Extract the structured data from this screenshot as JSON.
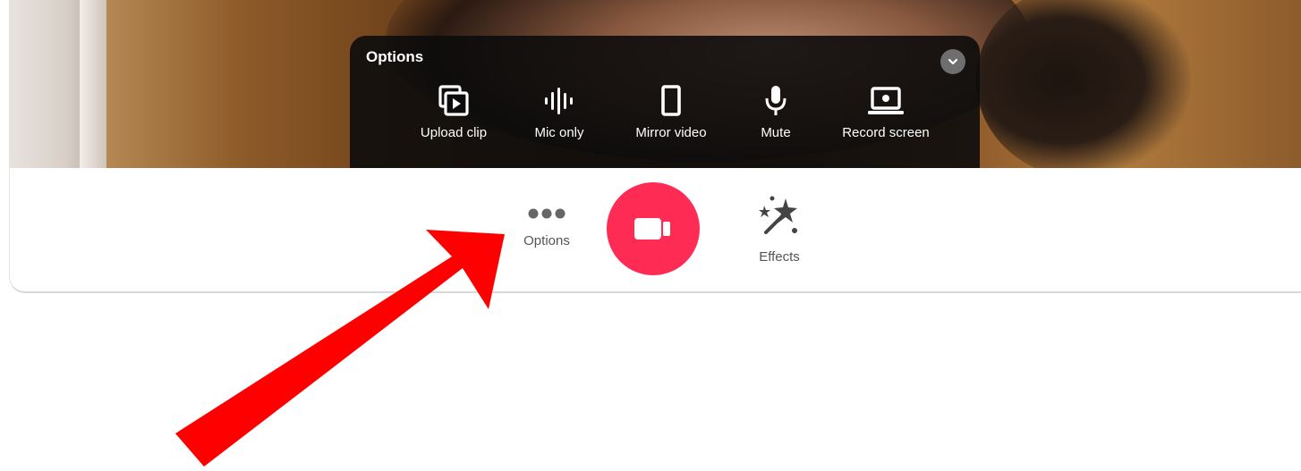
{
  "panel": {
    "title": "Options",
    "tools": [
      {
        "label": "Upload clip",
        "icon": "upload-clip-icon"
      },
      {
        "label": "Mic only",
        "icon": "waveform-icon"
      },
      {
        "label": "Mirror video",
        "icon": "phone-frame-icon"
      },
      {
        "label": "Mute",
        "icon": "microphone-icon"
      },
      {
        "label": "Record screen",
        "icon": "laptop-icon"
      }
    ]
  },
  "bar": {
    "options_label": "Options",
    "effects_label": "Effects"
  },
  "colors": {
    "record": "#fe2c55",
    "annotation_arrow": "#ff0000",
    "panel_bg": "#0c0c0c"
  }
}
